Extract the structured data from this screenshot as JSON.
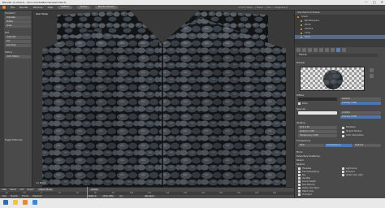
{
  "window": {
    "title": "Blender [C:\\Users\\...\\Documents\\Blender\\wall.blend]",
    "controls": [
      "—",
      "□",
      "✕"
    ]
  },
  "menubar": {
    "items": [
      "File",
      "Render",
      "Window",
      "Help"
    ],
    "layout": "Default",
    "scene": "Scene",
    "engine": "Blender Render",
    "stats": "v2.79 | Verts:... | Faces:... | Tris:... | Objects:1/3"
  },
  "toolshelf": {
    "sections": [
      {
        "title": "Transform",
        "buttons": [
          "Translate",
          "Rotate",
          "Scale"
        ]
      },
      {
        "title": "Edit",
        "buttons": [
          "Duplicate",
          "Join",
          "Set Origin"
        ]
      },
      {
        "title": "History",
        "buttons": [
          "Undo History"
        ]
      }
    ],
    "bottom_label": "Toggle Editmode"
  },
  "viewport": {
    "header": "User Persp",
    "object_label": "(1) Plane",
    "menu": [
      "View",
      "Select",
      "Add",
      "Object"
    ],
    "mode": "Object Mode",
    "shading": "Global"
  },
  "timeline": {
    "menu": [
      "View",
      "Marker",
      "Frame",
      "Playback"
    ],
    "start": "Start: 1",
    "end": "End: 250",
    "current": "1",
    "sync": "No Sync",
    "ticks": [
      "-40",
      "-20",
      "0",
      "20",
      "40",
      "60",
      "80",
      "100",
      "120",
      "140",
      "160",
      "180",
      "200",
      "220",
      "240",
      "260"
    ]
  },
  "outliner": {
    "header": "View  Search  All Scenes",
    "rows": [
      "Scene",
      "RenderLayers",
      "World",
      "Camera",
      "Lamp",
      "Plane"
    ]
  },
  "properties": {
    "material_slot": "Material",
    "panels": [
      "Preview",
      "Diffuse",
      "Specular",
      "Shading",
      "Transparency",
      "Mirror",
      "Subsurface Scattering",
      "Strand",
      "Options",
      "Shadow"
    ],
    "diffuse_shader": "Lambert",
    "diffuse_intensity": "Intensity: 0.800",
    "specular_shader": "CookTorr",
    "specular_intensity": "Intensity: 0.500",
    "ramp_label": "Ramp",
    "emit": "Emit: 0.00",
    "ambient": "Ambient: 1.000",
    "translucency": "Translucency: 0.000",
    "shadeless": "Shadeless",
    "tangent": "Tangent Shading",
    "cubic": "Cubic Interpolation",
    "transp_buttons": [
      "Mask",
      "Z Transparency",
      "Raytrace"
    ],
    "options_checkboxes": [
      "Traceable",
      "Full Oversampling",
      "Sky",
      "Use Mist",
      "Invert Z Depth",
      "Face Textures",
      "Vertex Color Paint",
      "Object Color",
      "Uv Project"
    ],
    "right_checkboxes": [
      "Light Group",
      "Exclusive",
      "Vertex Color Light"
    ]
  },
  "colors": {
    "accent": "#5680c2",
    "playhead": "#59c159",
    "outliner_bullet": "#e8a13a"
  }
}
